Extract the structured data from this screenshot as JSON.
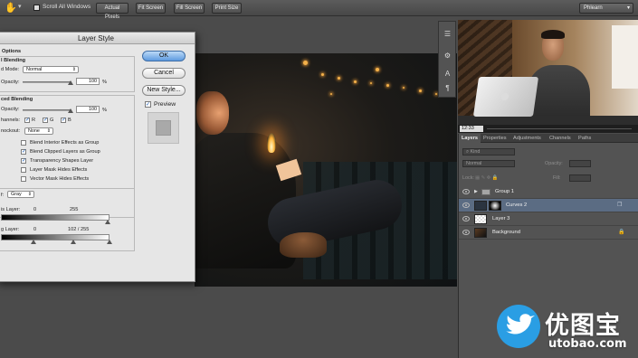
{
  "options_bar": {
    "scroll_all_windows": "Scroll All Windows",
    "buttons": [
      "Actual Pixels",
      "Fit Screen",
      "Fill Screen",
      "Print Size"
    ],
    "workspace": "Phlearn"
  },
  "dialog": {
    "title": "Layer Style",
    "options_heading": "Options",
    "general_heading": "l Blending",
    "blend_mode_label": "d Mode:",
    "blend_mode_value": "Normal",
    "opacity_label": "Opacity:",
    "opacity_value": "100",
    "percent": "%",
    "advanced_heading": "ced Blending",
    "fill_opacity_label": "Opacity:",
    "fill_opacity_value": "100",
    "channels_label": "hannels:",
    "channels": [
      "R",
      "G",
      "B"
    ],
    "knockout_label": "nockout:",
    "knockout_value": "None",
    "checkboxes": [
      {
        "label": "Blend Interior Effects as Group",
        "checked": false
      },
      {
        "label": "Blend Clipped Layers as Group",
        "checked": true
      },
      {
        "label": "Transparency Shapes Layer",
        "checked": true
      },
      {
        "label": "Layer Mask Hides Effects",
        "checked": false
      },
      {
        "label": "Vector Mask Hides Effects",
        "checked": false
      }
    ],
    "blend_if_label": "f:",
    "blend_if_value": "Gray",
    "this_layer_label": "is Layer:",
    "this_layer_min": "0",
    "this_layer_max": "255",
    "underlying_label": "g Layer:",
    "underlying_min": "0",
    "underlying_max": "102  /  255",
    "buttons": {
      "ok": "OK",
      "cancel": "Cancel",
      "new_style": "New Style..."
    },
    "preview_label": "Preview"
  },
  "video": {
    "timecode": "12:33"
  },
  "layers_panel": {
    "tabs": [
      "Layers",
      "Properties",
      "Adjustments",
      "Channels",
      "Paths"
    ],
    "kind_label": "Kind",
    "blend_mode": "Normal",
    "opacity_label": "Opacity:",
    "lock_label": "Lock:",
    "fill_label": "Fill:",
    "layers": [
      {
        "name": "Group 1",
        "type": "group"
      },
      {
        "name": "Curves 2",
        "type": "adjustment",
        "selected": true
      },
      {
        "name": "Layer 3",
        "type": "pixel"
      },
      {
        "name": "Background",
        "type": "background"
      }
    ]
  },
  "watermark": {
    "brand_cn": "优图宝",
    "url": "utobao.com"
  },
  "colors": {
    "ok_blue": "#5e9bdf",
    "selected_layer": "#5b6c83",
    "watermark_blue": "#2a9ee4"
  }
}
